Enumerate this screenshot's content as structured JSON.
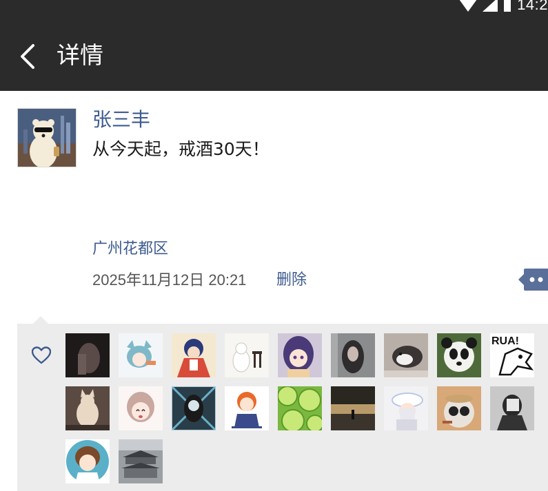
{
  "status_bar": {
    "time": "14:2"
  },
  "header": {
    "title": "详情"
  },
  "post": {
    "author": "张三丰",
    "text": "从今天起，戒酒30天！",
    "location": "广州花都区",
    "time": "2025年11月12日 20:21",
    "delete_label": "删除"
  },
  "likes": {
    "avatars": [
      "like-avatar-1",
      "like-avatar-2",
      "like-avatar-3",
      "like-avatar-4",
      "like-avatar-5",
      "like-avatar-6",
      "like-avatar-7",
      "like-avatar-8",
      "like-avatar-9",
      "like-avatar-10",
      "like-avatar-11",
      "like-avatar-12",
      "like-avatar-13",
      "like-avatar-14",
      "like-avatar-15",
      "like-avatar-16",
      "like-avatar-17",
      "like-avatar-18",
      "like-avatar-19",
      "like-avatar-20"
    ],
    "avatar_texts": {
      "rua": "RUA!"
    }
  },
  "colors": {
    "header_bg": "#2b2b2b",
    "link": "#3d5a8f",
    "panel_bg": "#ececec"
  }
}
